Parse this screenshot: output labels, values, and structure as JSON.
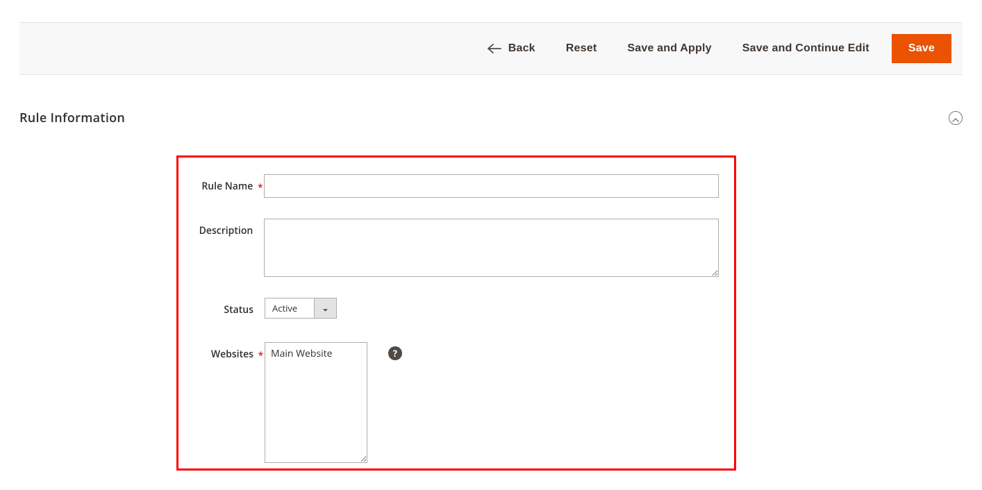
{
  "toolbar": {
    "back_label": "Back",
    "reset_label": "Reset",
    "save_apply_label": "Save and Apply",
    "save_continue_label": "Save and Continue Edit",
    "save_label": "Save"
  },
  "section": {
    "title": "Rule Information"
  },
  "form": {
    "rule_name_label": "Rule Name",
    "rule_name_value": "",
    "description_label": "Description",
    "description_value": "",
    "status_label": "Status",
    "status_value": "Active",
    "websites_label": "Websites",
    "websites_options": [
      "Main Website"
    ]
  },
  "colors": {
    "primary": "#eb5202",
    "highlight_border": "#ff0000"
  }
}
